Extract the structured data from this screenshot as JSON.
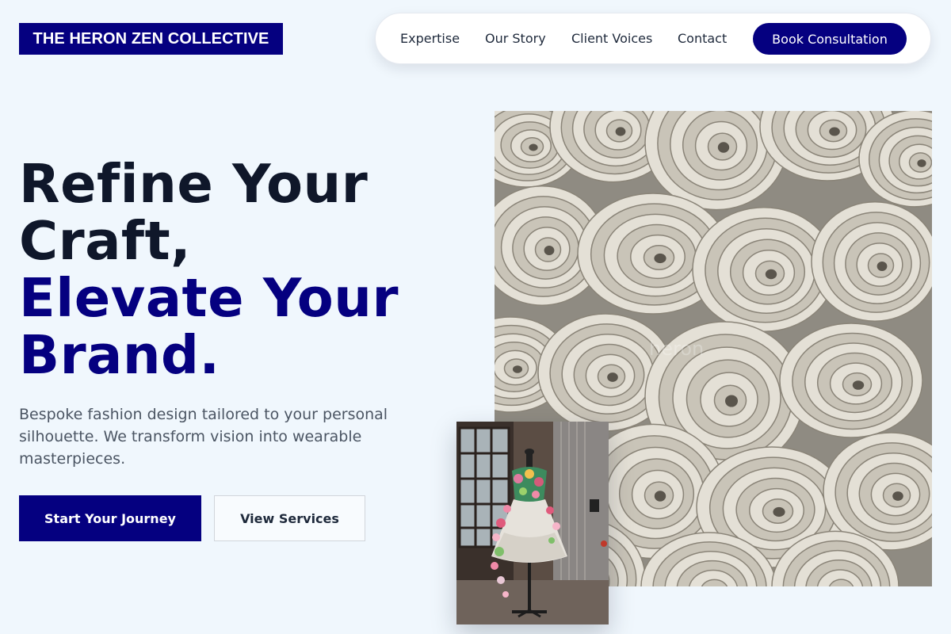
{
  "brand": {
    "name": "THE HERON ZEN COLLECTIVE"
  },
  "nav": {
    "links": [
      "Expertise",
      "Our Story",
      "Client Voices",
      "Contact"
    ],
    "cta": "Book Consultation"
  },
  "hero": {
    "headline_lines": [
      "Refine Your",
      "Craft,"
    ],
    "headline_accent_lines": [
      "Elevate Your",
      "Brand."
    ],
    "subcopy": "Bespoke fashion design tailored to your personal silhouette. We transform vision into wearable masterpieces.",
    "primary_cta": "Start Your Journey",
    "secondary_cta": "View Services"
  },
  "images": {
    "main": "rolled-fabric-photo",
    "secondary": "floral-dress-on-mannequin-photo",
    "watermark": "heron"
  },
  "colors": {
    "brand": "#050080",
    "background": "#f0f7fd",
    "text": "#0f172a",
    "muted": "#4b5563"
  }
}
